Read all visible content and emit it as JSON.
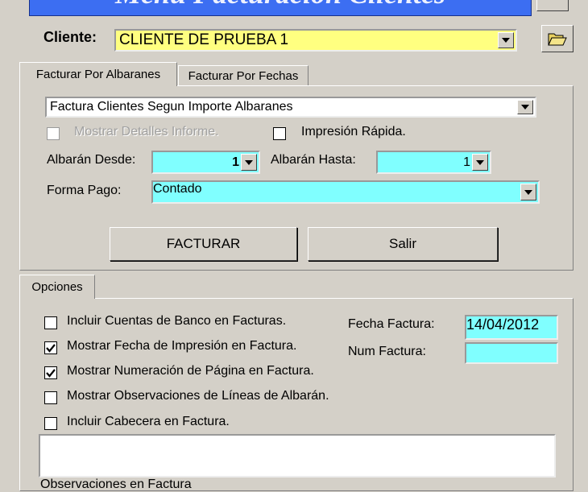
{
  "window": {
    "title": "Menú Facturación Clientes"
  },
  "cliente": {
    "label": "Cliente:",
    "value": "CLIENTE DE PRUEBA 1"
  },
  "tabs": [
    {
      "label": "Facturar Por Albaranes",
      "active": true
    },
    {
      "label": "Facturar Por Fechas",
      "active": false
    }
  ],
  "report": {
    "value": "Factura Clientes Segun Importe Albaranes"
  },
  "checks_top": {
    "mostrar_detalles": {
      "label": "Mostrar Detalles Informe.",
      "checked": false,
      "enabled": false
    },
    "impresion_rapida": {
      "label": "Impresión Rápida.",
      "checked": false,
      "enabled": true
    }
  },
  "albaran_desde": {
    "label": "Albarán Desde:",
    "value": "1"
  },
  "albaran_hasta": {
    "label": "Albarán Hasta:",
    "value": "1"
  },
  "forma_pago": {
    "label": "Forma Pago:",
    "value": "Contado"
  },
  "buttons": {
    "facturar": "FACTURAR",
    "salir": "Salir"
  },
  "opciones": {
    "tab_label": "Opciones",
    "checks": [
      {
        "label": "Incluir Cuentas de Banco en Facturas.",
        "checked": false
      },
      {
        "label": "Mostrar Fecha de Impresión en Factura.",
        "checked": true
      },
      {
        "label": "Mostrar Numeración de Página en Factura.",
        "checked": true
      },
      {
        "label": "Mostrar Observaciones de Líneas de Albarán.",
        "checked": false
      },
      {
        "label": "Incluir Cabecera en Factura.",
        "checked": false
      }
    ],
    "fecha_factura": {
      "label": "Fecha Factura:",
      "value": "14/04/2012"
    },
    "num_factura": {
      "label": "Num Factura:",
      "value": ""
    },
    "observaciones_label": "Observaciones en Factura"
  },
  "colors": {
    "field_yellow": "#ffff80",
    "field_cyan": "#80ffff",
    "banner_blue": "#3c6ef2",
    "window_bg": "#d4d0c8"
  },
  "icons": [
    "open-folder-icon",
    "chevron-down-icon",
    "check-icon"
  ]
}
